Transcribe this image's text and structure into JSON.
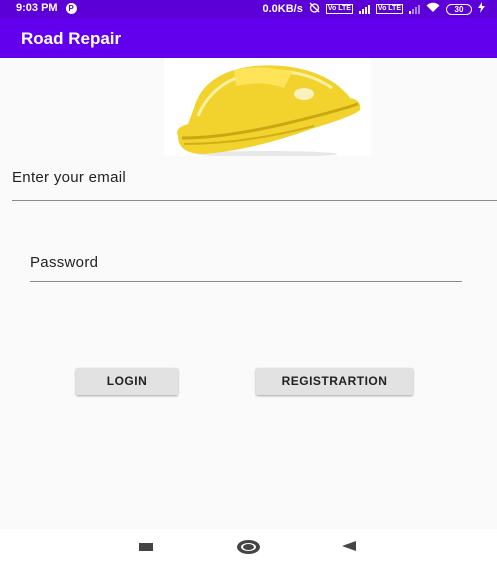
{
  "status_bar": {
    "time": "9:03 PM",
    "notification_icon": "P",
    "network_speed": "0.0KB/s",
    "volte_label_1": "Vo LTE",
    "volte_label_2": "Vo LTE",
    "battery": "30"
  },
  "app_bar": {
    "title": "Road Repair"
  },
  "logo": {
    "name": "yellow-helmet-image",
    "color": "#f2d22c"
  },
  "form": {
    "email_placeholder": "Enter your email",
    "password_placeholder": "Password"
  },
  "buttons": {
    "login": "LOGIN",
    "register": "REGISTRARTION"
  },
  "colors": {
    "status_bar": "#5b00d6",
    "app_bar": "#6200ee",
    "background": "#fafafa"
  }
}
